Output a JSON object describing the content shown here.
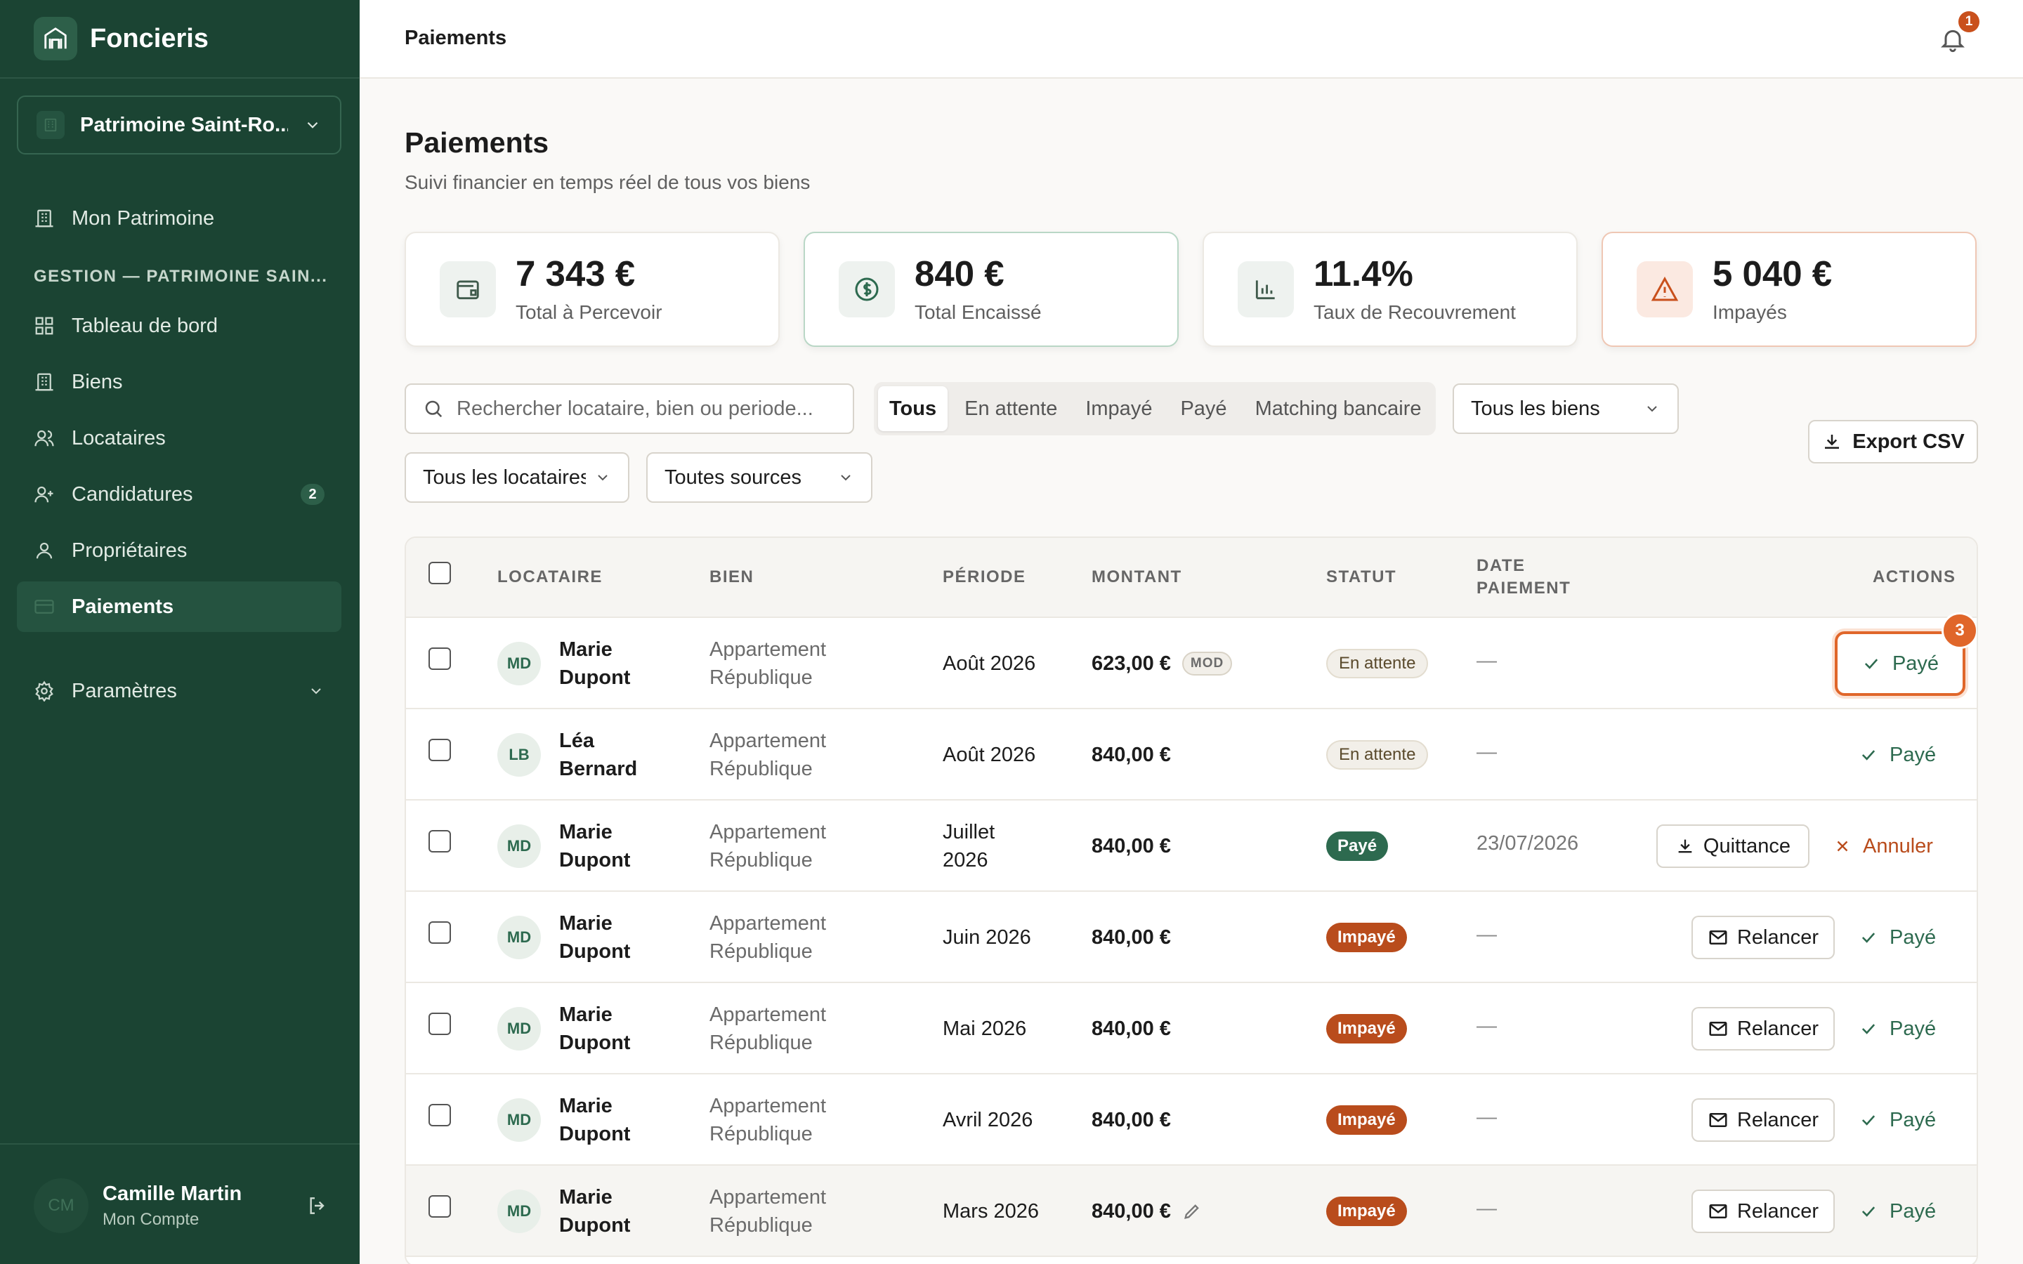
{
  "sidebar": {
    "brand": "Foncieris",
    "workspace": "Patrimoine Saint-Ro...",
    "top_item": "Mon Patrimoine",
    "section_label": "GESTION — PATRIMOINE SAIN...",
    "items": [
      {
        "label": "Tableau de bord",
        "icon": "grid-icon"
      },
      {
        "label": "Biens",
        "icon": "building-icon"
      },
      {
        "label": "Locataires",
        "icon": "users-icon"
      },
      {
        "label": "Candidatures",
        "icon": "user-plus-icon",
        "badge": "2"
      },
      {
        "label": "Propriétaires",
        "icon": "owners-icon"
      },
      {
        "label": "Paiements",
        "icon": "card-icon",
        "active": true
      }
    ],
    "settings": "Paramètres",
    "user": {
      "initials": "CM",
      "name": "Camille Martin",
      "sub": "Mon Compte"
    }
  },
  "topbar": {
    "title": "Paiements",
    "notifications": "1"
  },
  "page": {
    "title": "Paiements",
    "subtitle": "Suivi financier en temps réel de tous vos biens"
  },
  "stats": [
    {
      "value": "7 343 €",
      "label": "Total à Percevoir",
      "icon": "wallet-icon"
    },
    {
      "value": "840 €",
      "label": "Total Encaissé",
      "icon": "dollar-circle-icon"
    },
    {
      "value": "11.4%",
      "label": "Taux de Recouvrement",
      "icon": "bar-chart-icon"
    },
    {
      "value": "5 040 €",
      "label": "Impayés",
      "icon": "warning-icon"
    }
  ],
  "filters": {
    "search_placeholder": "Rechercher locataire, bien ou periode...",
    "tabs": [
      "Tous",
      "En attente",
      "Impayé",
      "Payé",
      "Matching bancaire"
    ],
    "active_tab": "Tous",
    "biens": "Tous les biens",
    "locataires": "Tous les locataires",
    "sources": "Toutes sources",
    "export": "Export CSV"
  },
  "table": {
    "headers": {
      "locataire": "LOCATAIRE",
      "bien": "BIEN",
      "periode": "PÉRIODE",
      "montant": "MONTANT",
      "statut": "STATUT",
      "date_line1": "DATE",
      "date_line2": "PAIEMENT",
      "actions": "ACTIONS"
    },
    "rows": [
      {
        "initials": "MD",
        "first": "Marie",
        "last": "Dupont",
        "bien1": "Appartement",
        "bien2": "République",
        "periode": "Août 2026",
        "montant": "623,00 €",
        "mod": "MOD",
        "statut": "En attente",
        "date": "—",
        "paye": "Payé",
        "step": "3"
      },
      {
        "initials": "LB",
        "first": "Léa",
        "last": "Bernard",
        "bien1": "Appartement",
        "bien2": "République",
        "periode": "Août 2026",
        "montant": "840,00 €",
        "statut": "En attente",
        "date": "—",
        "paye": "Payé"
      },
      {
        "initials": "MD",
        "first": "Marie",
        "last": "Dupont",
        "bien1": "Appartement",
        "bien2": "République",
        "periode": "Juillet 2026",
        "montant": "840,00 €",
        "statut": "Payé",
        "date": "23/07/2026",
        "quittance": "Quittance",
        "annuler": "Annuler"
      },
      {
        "initials": "MD",
        "first": "Marie",
        "last": "Dupont",
        "bien1": "Appartement",
        "bien2": "République",
        "periode": "Juin 2026",
        "montant": "840,00 €",
        "statut": "Impayé",
        "date": "—",
        "relancer": "Relancer",
        "paye": "Payé"
      },
      {
        "initials": "MD",
        "first": "Marie",
        "last": "Dupont",
        "bien1": "Appartement",
        "bien2": "République",
        "periode": "Mai 2026",
        "montant": "840,00 €",
        "statut": "Impayé",
        "date": "—",
        "relancer": "Relancer",
        "paye": "Payé"
      },
      {
        "initials": "MD",
        "first": "Marie",
        "last": "Dupont",
        "bien1": "Appartement",
        "bien2": "République",
        "periode": "Avril 2026",
        "montant": "840,00 €",
        "statut": "Impayé",
        "date": "—",
        "relancer": "Relancer",
        "paye": "Payé"
      },
      {
        "initials": "MD",
        "first": "Marie",
        "last": "Dupont",
        "bien1": "Appartement",
        "bien2": "République",
        "periode": "Mars 2026",
        "montant": "840,00 €",
        "statut": "Impayé",
        "date": "—",
        "relancer": "Relancer",
        "paye": "Payé"
      }
    ]
  },
  "colors": {
    "sidebar": "#1b4433",
    "accent_green": "#2d6a4f",
    "accent_orange": "#e0662a",
    "unpaid": "#b94c1c"
  }
}
